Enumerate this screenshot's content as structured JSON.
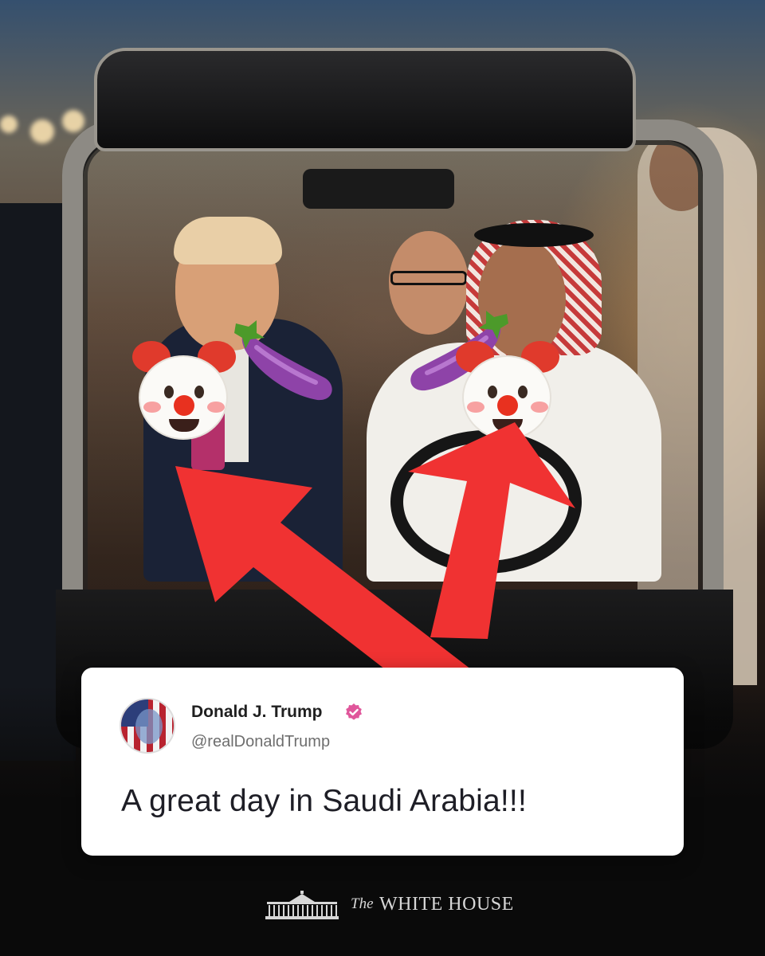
{
  "tweet": {
    "name": "Donald J. Trump",
    "handle": "@realDonaldTrump",
    "text": "A great day in Saudi Arabia!!!",
    "verified_badge_color": "#e0569b"
  },
  "footer": {
    "brand_prefix": "The",
    "brand_name": "WHITE HOUSE"
  },
  "stickers": {
    "clown_emoji": "clown-face",
    "eggplant_emoji": "eggplant"
  },
  "colors": {
    "arrow": "#f03232",
    "card_background": "#ffffff",
    "page_background": "#0a0a0a"
  }
}
